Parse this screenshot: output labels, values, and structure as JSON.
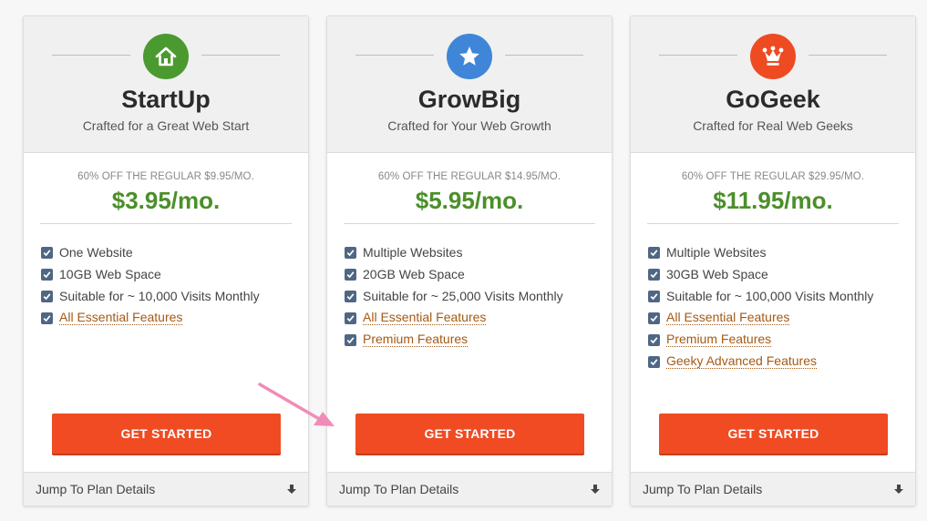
{
  "plans": [
    {
      "name": "StartUp",
      "tagline": "Crafted for a Great Web Start",
      "regular": "60% OFF THE REGULAR $9.95/MO.",
      "price": "$3.95/mo.",
      "icon": "home-icon",
      "icon_color": "#4b9a2f",
      "features": [
        {
          "text": "One Website"
        },
        {
          "text": "10GB Web Space"
        },
        {
          "text": "Suitable for ~ 10,000 Visits Monthly"
        },
        {
          "text": "All Essential Features",
          "link": true
        }
      ],
      "cta": "GET STARTED",
      "footer": "Jump To Plan Details"
    },
    {
      "name": "GrowBig",
      "tagline": "Crafted for Your Web Growth",
      "regular": "60% OFF THE REGULAR $14.95/MO.",
      "price": "$5.95/mo.",
      "icon": "star-icon",
      "icon_color": "#3f86d8",
      "features": [
        {
          "text": "Multiple Websites"
        },
        {
          "text": "20GB Web Space"
        },
        {
          "text": "Suitable for ~ 25,000 Visits Monthly"
        },
        {
          "text": "All Essential Features",
          "link": true
        },
        {
          "text": "Premium Features",
          "link": true
        }
      ],
      "cta": "GET STARTED",
      "footer": "Jump To Plan Details"
    },
    {
      "name": "GoGeek",
      "tagline": "Crafted for Real Web Geeks",
      "regular": "60% OFF THE REGULAR $29.95/MO.",
      "price": "$11.95/mo.",
      "icon": "crown-icon",
      "icon_color": "#ee4b23",
      "features": [
        {
          "text": "Multiple Websites"
        },
        {
          "text": "30GB Web Space"
        },
        {
          "text": "Suitable for ~ 100,000 Visits Monthly"
        },
        {
          "text": "All Essential Features",
          "link": true
        },
        {
          "text": "Premium Features",
          "link": true
        },
        {
          "text": "Geeky Advanced Features",
          "link": true
        }
      ],
      "cta": "GET STARTED",
      "footer": "Jump To Plan Details"
    }
  ],
  "colors": {
    "price_green": "#4b8f29",
    "cta_orange": "#f04b23",
    "link_brown": "#a45a15",
    "check_blue": "#4f6784",
    "annotation_arrow": "#f08cb6"
  }
}
